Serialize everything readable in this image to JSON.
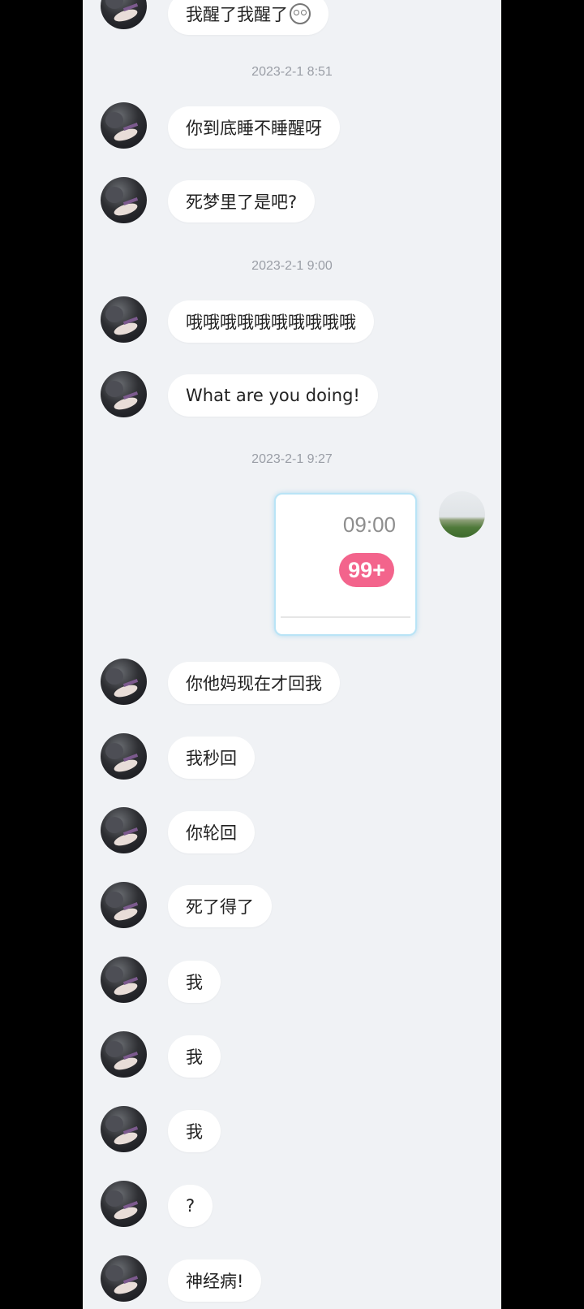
{
  "messages": {
    "m0": "我醒了我醒了",
    "ts1": "2023-2-1 8:51",
    "m1": "你到底睡不睡醒呀",
    "m2": "死梦里了是吧?",
    "ts2": "2023-2-1 9:00",
    "m3": "哦哦哦哦哦哦哦哦哦哦",
    "m4": "What are you doing!",
    "ts3": "2023-2-1 9:27",
    "card_time": "09:00",
    "card_badge": "99+",
    "m5": "你他妈现在才回我",
    "m6": "我秒回",
    "m7": "你轮回",
    "m8": "死了得了",
    "m9": "我",
    "m10": "我",
    "m11": "我",
    "m12": "?",
    "m13": "神经病!"
  },
  "colors": {
    "background": "#f0f2f5",
    "bubble": "#ffffff",
    "badge": "#f3648c",
    "card_border": "#b9e4f6"
  },
  "icons": {
    "emoji": "surprised-face-emoji-icon",
    "contact_avatar": "contact-avatar",
    "my_avatar": "my-avatar-landscape"
  }
}
